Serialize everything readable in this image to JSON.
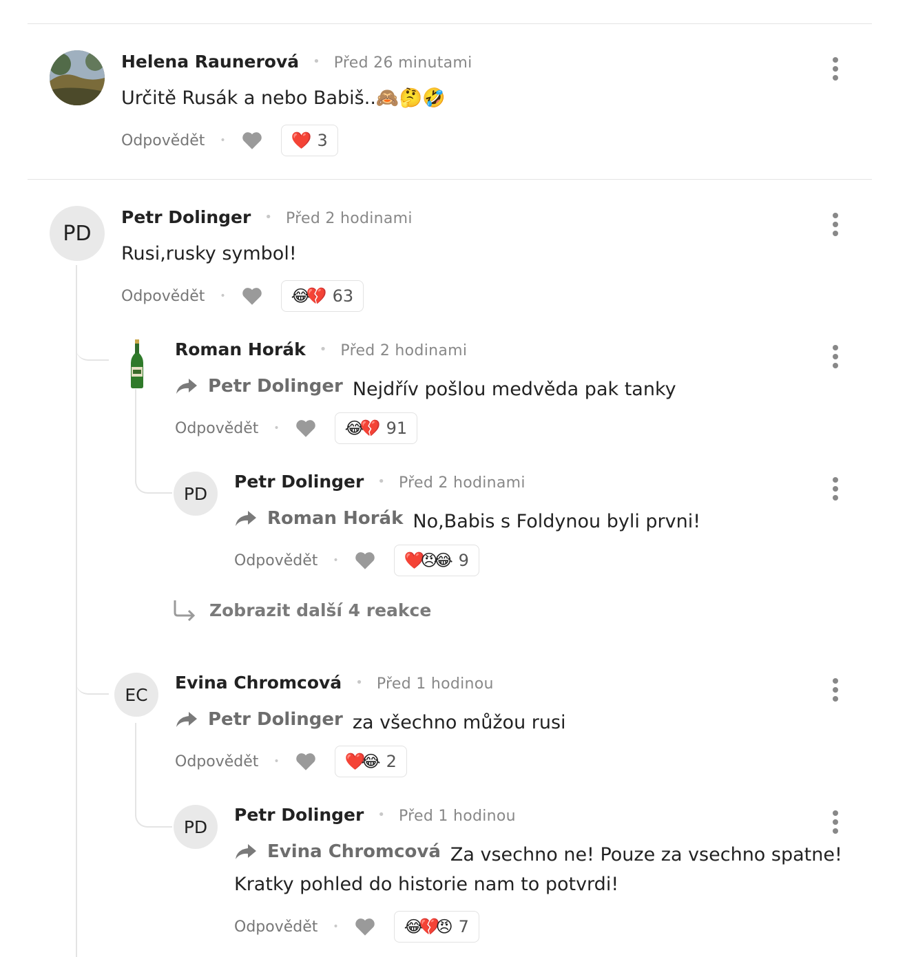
{
  "comments": [
    {
      "author": "Helena Raunerová",
      "time": "Před 26 minutami",
      "text": "Určitě Rusák a nebo Babiš..",
      "text_emojis": "🙈🤔🤣",
      "reply_label": "Odpovědět",
      "reaction_emojis": [
        "❤️"
      ],
      "reaction_count": "3",
      "avatar_icon": "landscape-photo"
    },
    {
      "author": "Petr Dolinger",
      "initials": "PD",
      "time": "Před 2 hodinami",
      "text": "Rusi,rusky symbol!",
      "reply_label": "Odpovědět",
      "reaction_emojis": [
        "😂",
        "💔"
      ],
      "reaction_count": "63"
    },
    {
      "author": "Roman Horák",
      "time": "Před 2 hodinami",
      "reply_to": "Petr Dolinger",
      "text": "Nejdřív pošlou medvěda pak tanky",
      "reply_label": "Odpovědět",
      "reaction_emojis": [
        "😂",
        "💔"
      ],
      "reaction_count": "91",
      "avatar_icon": "beer-bottle"
    },
    {
      "author": "Petr Dolinger",
      "initials": "PD",
      "time": "Před 2 hodinami",
      "reply_to": "Roman Horák",
      "text": "No,Babis s Foldynou byli prvni!",
      "reply_label": "Odpovědět",
      "reaction_emojis": [
        "❤️",
        "😠",
        "😂"
      ],
      "reaction_count": "9"
    },
    {
      "author": "Evina Chromcová",
      "initials": "EC",
      "time": "Před 1 hodinou",
      "reply_to": "Petr Dolinger",
      "text": "za všechno můžou rusi",
      "reply_label": "Odpovědět",
      "reaction_emojis": [
        "❤️",
        "😂"
      ],
      "reaction_count": "2"
    },
    {
      "author": "Petr Dolinger",
      "initials": "PD",
      "time": "Před 1 hodinou",
      "reply_to": "Evina Chromcová",
      "text": "Za vsechno ne! Pouze za vsechno spatne!",
      "text_line2": "Kratky pohled do historie nam to potvrdi!",
      "reply_label": "Odpovědět",
      "reaction_emojis": [
        "😂",
        "💔",
        "😠"
      ],
      "reaction_count": "7"
    }
  ],
  "show_more": {
    "label": "Zobrazit další 4 reakce"
  },
  "colors": {
    "heart_red": "#e8233c",
    "muted": "#888888",
    "author": "#222222"
  }
}
